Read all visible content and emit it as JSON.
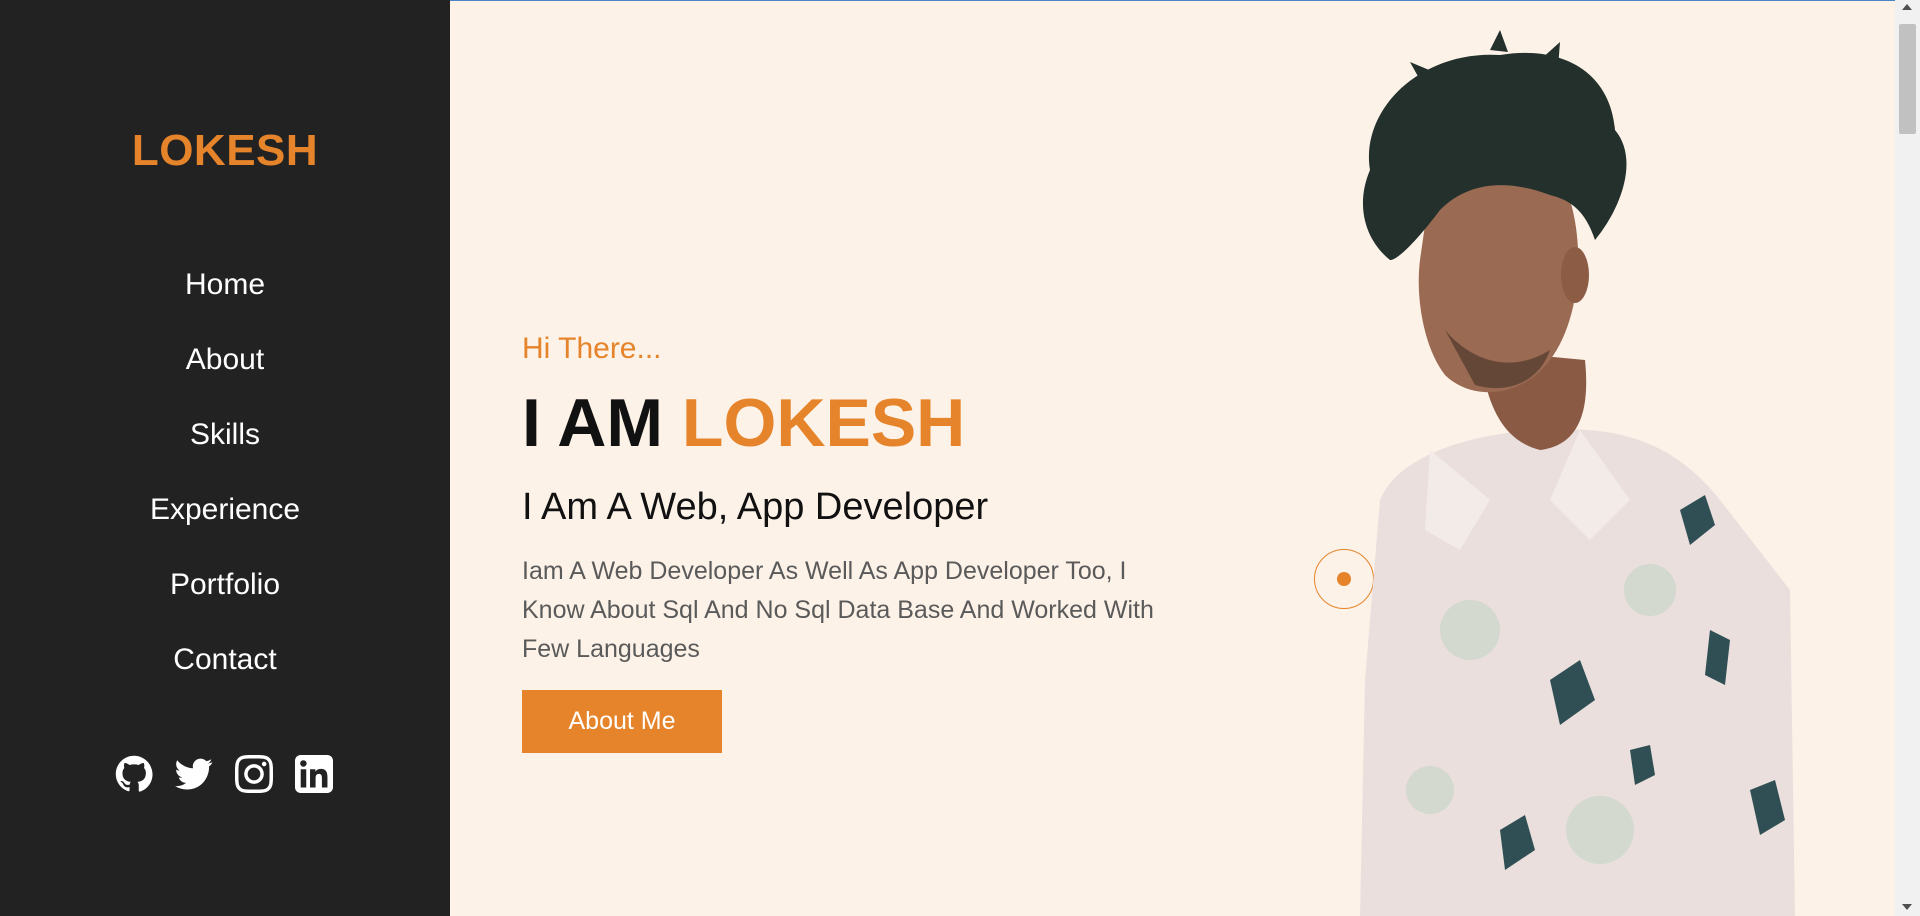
{
  "sidebar": {
    "brand": "LOKESH",
    "nav": [
      "Home",
      "About",
      "Skills",
      "Experience",
      "Portfolio",
      "Contact"
    ],
    "socials": [
      "github-icon",
      "twitter-icon",
      "instagram-icon",
      "linkedin-icon"
    ]
  },
  "hero": {
    "greeting": "Hi There...",
    "title_prefix": "I AM",
    "title_name": "LOKESH",
    "subtitle": "I Am A Web, App Developer",
    "description": "Iam A Web Developer As Well As App Developer Too, I Know About Sql And No Sql Data Base And Worked With Few Languages",
    "button_label": "About Me"
  },
  "colors": {
    "accent": "#e5842a",
    "sidebar_bg": "#222222",
    "page_bg": "#fdf2e8"
  }
}
